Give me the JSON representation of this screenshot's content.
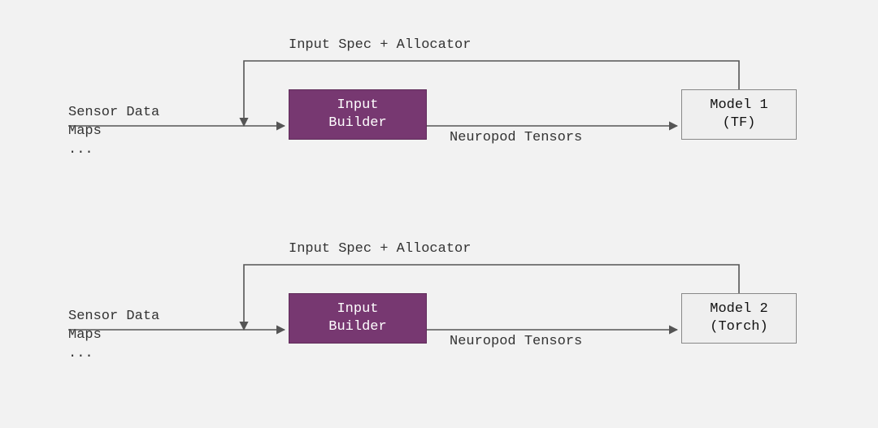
{
  "pipelines": [
    {
      "source_label": "Sensor Data\nMaps\n...",
      "builder_label": "Input\nBuilder",
      "spec_label": "Input Spec + Allocator",
      "tensor_label": "Neuropod Tensors",
      "model_label": "Model 1\n(TF)"
    },
    {
      "source_label": "Sensor Data\nMaps\n...",
      "builder_label": "Input\nBuilder",
      "spec_label": "Input Spec + Allocator",
      "tensor_label": "Neuropod Tensors",
      "model_label": "Model 2\n(Torch)"
    }
  ],
  "colors": {
    "builder_bg": "#773871",
    "model_bg": "#efefef",
    "canvas_bg": "#f2f2f2"
  }
}
